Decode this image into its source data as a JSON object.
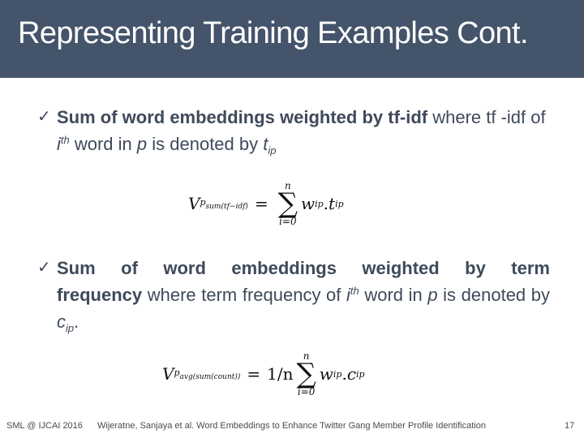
{
  "slide": {
    "title": "Representing Training Examples Cont.",
    "bullets": [
      {
        "icon": "checkmark-icon",
        "check": "✓",
        "bold": "Sum of word embeddings weighted by tf-idf",
        "rest_1": " where tf -idf of ",
        "i": "i",
        "th": "th",
        "rest_2": " word in ",
        "p": "p",
        "rest_3": " is denoted by ",
        "var": "t",
        "var_sub": "ip"
      },
      {
        "icon": "checkmark-icon",
        "check": "✓",
        "bold_1": "Sum of word embeddings weighted by term",
        "bold_2": "frequency",
        "rest_1": " where term frequency of ",
        "i": "i",
        "th": "th",
        "rest_2": " word in ",
        "p": "p",
        "rest_3": " is denoted by ",
        "var": "c",
        "var_sub": "ip",
        "end": "."
      }
    ],
    "equations": [
      {
        "lhs": "V",
        "lhs_sub": "p",
        "lhs_subsub": "sum(tf−idf)",
        "op": "=",
        "coef": "",
        "sum_upper": "n",
        "sum_lower": "i=0",
        "sigma": "∑",
        "term_w": "w",
        "term_w_sub": "ip",
        "dot": ".",
        "term_v": "t",
        "term_v_sub": "ip"
      },
      {
        "lhs": "V",
        "lhs_sub": "p",
        "lhs_subsub": "avg(sum(count))",
        "op": "=",
        "coef": "1/n",
        "sum_upper": "n",
        "sum_lower": "i=0",
        "sigma": "∑",
        "term_w": "w",
        "term_w_sub": "ip",
        "dot": ".",
        "term_v": "c",
        "term_v_sub": "ip"
      }
    ]
  },
  "footer": {
    "left": "SML @ IJCAI 2016",
    "center": "Wijeratne, Sanjaya et al. Word Embeddings to Enhance Twitter Gang Member Profile Identification",
    "page_number": "17"
  }
}
